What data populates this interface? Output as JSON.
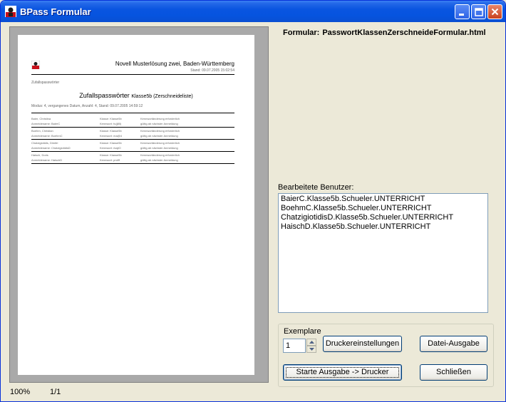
{
  "window": {
    "title": "BPass Formular"
  },
  "formular": {
    "label": "Formular:",
    "filename": "PasswortKlassenZerschneideFormular.html"
  },
  "preview": {
    "school": "Novell Musterlösung zwei, Baden-Württemberg",
    "stand": "Stand: 09.07.2005 15:02:54",
    "caption": "Zufallspasswörter",
    "title_main": "Zufallspasswörter",
    "title_small": "Klasse5b (Zerschneideliste)",
    "modus": "Modus: 4, vergangenes Datum, Anzahl: 4, Stand: 09.07.2005 14:59:12",
    "rows": [
      {
        "name": "Baier, Christina",
        "login": "Anmeldename: BaierC",
        "klasse": "Klasse: Klasse5b",
        "kennwort": "Kennwort: fu(j8ll)",
        "hinweis1": "Kennwortänderung erforderlich",
        "hinweis2": "gültig ab nächster Anmeldung"
      },
      {
        "name": "Boehm, Christian",
        "login": "Anmeldename: BoehmC",
        "klasse": "Klasse: Klasse5b",
        "kennwort": "Kennwort: ma@4",
        "hinweis1": "Kennwortänderung erforderlich",
        "hinweis2": "gültig ab nächster Anmeldung"
      },
      {
        "name": "Chatzigiotidis, Dimitri",
        "login": "Anmeldename: ChatzigiotidisD",
        "klasse": "Klasse: Klasse5b",
        "kennwort": "Kennwort: rkajiO",
        "hinweis1": "Kennwortänderung erforderlich",
        "hinweis2": "gültig ab nächster Anmeldung"
      },
      {
        "name": "Haisch, Doris",
        "login": "Anmeldename: HaischD",
        "klasse": "Klasse: Klasse5b",
        "kennwort": "Kennwort: pn#ff",
        "hinweis1": "Kennwortänderung erforderlich",
        "hinweis2": "gültig ab nächster Anmeldung"
      }
    ]
  },
  "users": {
    "label": "Bearbeitete Benutzer:",
    "items": [
      "BaierC.Klasse5b.Schueler.UNTERRICHT",
      "BoehmC.Klasse5b.Schueler.UNTERRICHT",
      "ChatzigiotidisD.Klasse5b.Schueler.UNTERRICHT",
      "HaischD.Klasse5b.Schueler.UNTERRICHT"
    ]
  },
  "exemplare": {
    "label": "Exemplare",
    "value": "1"
  },
  "buttons": {
    "druckereinstellungen": "Druckereinstellungen",
    "datei_ausgabe": "Datei-Ausgabe",
    "starte": "Starte Ausgabe -> Drucker",
    "schliessen": "Schließen"
  },
  "status": {
    "zoom": "100%",
    "page": "1/1"
  },
  "colors": {
    "titlebar": "#0A55E0",
    "window_bg": "#ECE9D8",
    "preview_bg": "#A9A9A9"
  }
}
